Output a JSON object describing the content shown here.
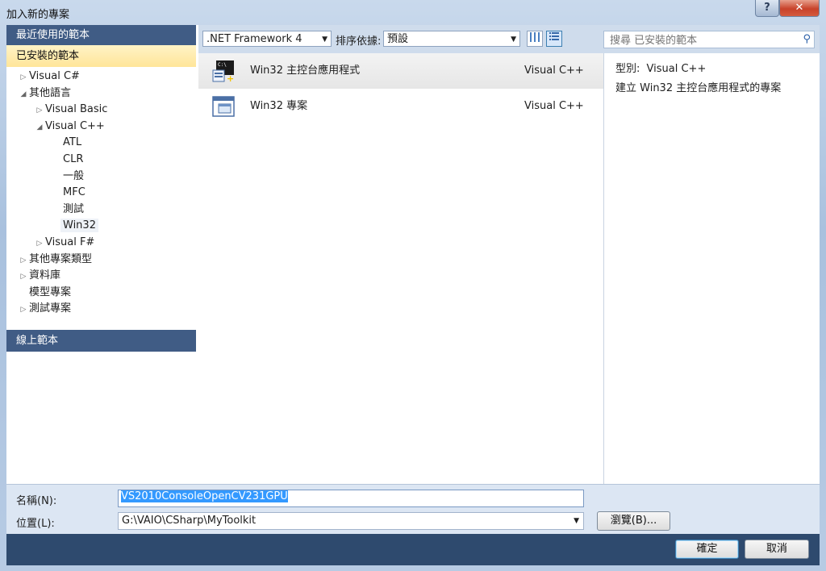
{
  "window": {
    "title": "加入新的專案",
    "help_label": "?",
    "close_label": "✕"
  },
  "left": {
    "recent_templates": "最近使用的範本",
    "installed_templates": "已安裝的範本",
    "online_templates": "線上範本",
    "tree": [
      {
        "label": "Visual C#",
        "level": 0,
        "arrow": "▷"
      },
      {
        "label": "其他語言",
        "level": 0,
        "arrow": "◢"
      },
      {
        "label": "Visual Basic",
        "level": 1,
        "arrow": "▷"
      },
      {
        "label": "Visual C++",
        "level": 1,
        "arrow": "◢"
      },
      {
        "label": "ATL",
        "level": 2,
        "arrow": ""
      },
      {
        "label": "CLR",
        "level": 2,
        "arrow": ""
      },
      {
        "label": "一般",
        "level": 2,
        "arrow": ""
      },
      {
        "label": "MFC",
        "level": 2,
        "arrow": ""
      },
      {
        "label": "測試",
        "level": 2,
        "arrow": ""
      },
      {
        "label": "Win32",
        "level": 2,
        "arrow": "",
        "selected": true
      },
      {
        "label": "Visual F#",
        "level": 1,
        "arrow": "▷"
      },
      {
        "label": "其他專案類型",
        "level": 0,
        "arrow": "▷"
      },
      {
        "label": "資料庫",
        "level": 0,
        "arrow": "▷"
      },
      {
        "label": "模型專案",
        "level": 0,
        "arrow": ""
      },
      {
        "label": "測試專案",
        "level": 0,
        "arrow": "▷"
      }
    ]
  },
  "toolbar": {
    "framework": ".NET Framework 4",
    "sort_label": "排序依據:",
    "sort_value": "預設",
    "search_placeholder": "搜尋 已安裝的範本"
  },
  "templates": [
    {
      "name": "Win32 主控台應用程式",
      "lang": "Visual C++",
      "selected": true,
      "icon": "console-app-icon"
    },
    {
      "name": "Win32 專案",
      "lang": "Visual C++",
      "selected": false,
      "icon": "win32-project-icon"
    }
  ],
  "details": {
    "type_label": "型別:",
    "type_value": "Visual C++",
    "description": "建立 Win32 主控台應用程式的專案"
  },
  "form": {
    "name_label": "名稱(N):",
    "name_value": "VS2010ConsoleOpenCV231GPU",
    "location_label": "位置(L):",
    "location_value": "G:\\VAIO\\CSharp\\MyToolkit",
    "browse_label": "瀏覽(B)..."
  },
  "buttons": {
    "ok": "確定",
    "cancel": "取消"
  },
  "colors": {
    "header_blue": "#405c85",
    "selection_yellow": "#ffe599",
    "footer": "#2e4a6e"
  }
}
